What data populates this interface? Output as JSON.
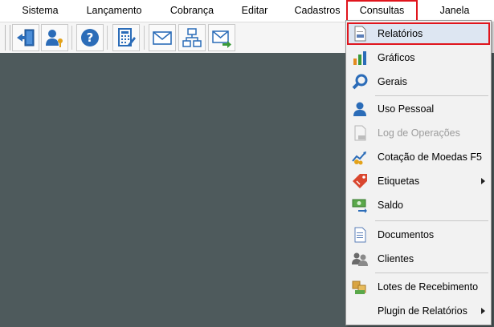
{
  "menubar": {
    "items": [
      {
        "label": "Sistema"
      },
      {
        "label": "Lançamento"
      },
      {
        "label": "Cobrança"
      },
      {
        "label": "Editar"
      },
      {
        "label": "Cadastros"
      },
      {
        "label": "Consultas"
      },
      {
        "label": "Janela"
      }
    ],
    "active": "Consultas"
  },
  "toolbar": {
    "buttons": [
      {
        "icon": "exit-door-icon"
      },
      {
        "icon": "user-key-icon"
      },
      {
        "icon": "help-question-icon"
      },
      {
        "icon": "calculator-edit-icon"
      },
      {
        "icon": "envelope-icon"
      },
      {
        "icon": "network-diagram-icon"
      },
      {
        "icon": "envelope-arrow-icon"
      }
    ]
  },
  "consultas_menu": {
    "items": [
      {
        "label": "Relatórios",
        "icon": "report-icon",
        "highlighted": true
      },
      {
        "label": "Gráficos",
        "icon": "bar-chart-icon"
      },
      {
        "label": "Gerais",
        "icon": "magnifier-icon"
      },
      {
        "label": "Uso Pessoal",
        "icon": "person-icon"
      },
      {
        "label": "Log de Operações",
        "icon": "log-file-icon",
        "disabled": true
      },
      {
        "label": "Cotação de Moedas F5",
        "icon": "currency-rate-icon"
      },
      {
        "label": "Etiquetas",
        "icon": "tag-icon",
        "submenu": true
      },
      {
        "label": "Saldo",
        "icon": "money-balance-icon"
      },
      {
        "label": "Documentos",
        "icon": "document-icon"
      },
      {
        "label": "Clientes",
        "icon": "clients-icon"
      },
      {
        "label": "Lotes de Recebimento",
        "icon": "receipt-batch-icon"
      },
      {
        "label": "Plugin de Relatórios",
        "icon": "",
        "submenu": true
      }
    ]
  },
  "colors": {
    "workspace": "#4e5a5c",
    "highlight_border": "#e0151d",
    "menu_background": "#f2f2f2"
  }
}
